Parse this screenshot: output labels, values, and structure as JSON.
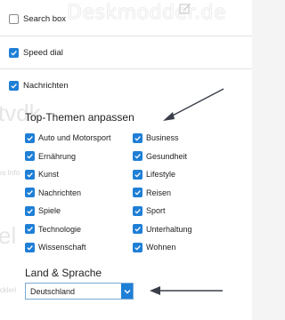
{
  "watermark": "Deskmodder.de",
  "ghost": {
    "t1": "tvdk",
    "t2": "es Info",
    "t3": "el",
    "t4": "lckleri"
  },
  "top_options": [
    {
      "label": "Search box",
      "checked": false
    },
    {
      "label": "Speed dial",
      "checked": true
    },
    {
      "label": "Nachrichten",
      "checked": true
    }
  ],
  "topics": {
    "title": "Top-Themen anpassen",
    "left": [
      {
        "label": "Auto und Motorsport",
        "checked": true
      },
      {
        "label": "Ernährung",
        "checked": true
      },
      {
        "label": "Kunst",
        "checked": true
      },
      {
        "label": "Nachrichten",
        "checked": true
      },
      {
        "label": "Spiele",
        "checked": true
      },
      {
        "label": "Technologie",
        "checked": true
      },
      {
        "label": "Wissenschaft",
        "checked": true
      }
    ],
    "right": [
      {
        "label": "Business",
        "checked": true
      },
      {
        "label": "Gesundheit",
        "checked": true
      },
      {
        "label": "Lifestyle",
        "checked": true
      },
      {
        "label": "Reisen",
        "checked": true
      },
      {
        "label": "Sport",
        "checked": true
      },
      {
        "label": "Unterhaltung",
        "checked": true
      },
      {
        "label": "Wohnen",
        "checked": true
      }
    ]
  },
  "region": {
    "title": "Land & Sprache",
    "selected": "Deutschland"
  },
  "colors": {
    "accent": "#1f7fd6",
    "arrow": "#3a3f4a"
  }
}
